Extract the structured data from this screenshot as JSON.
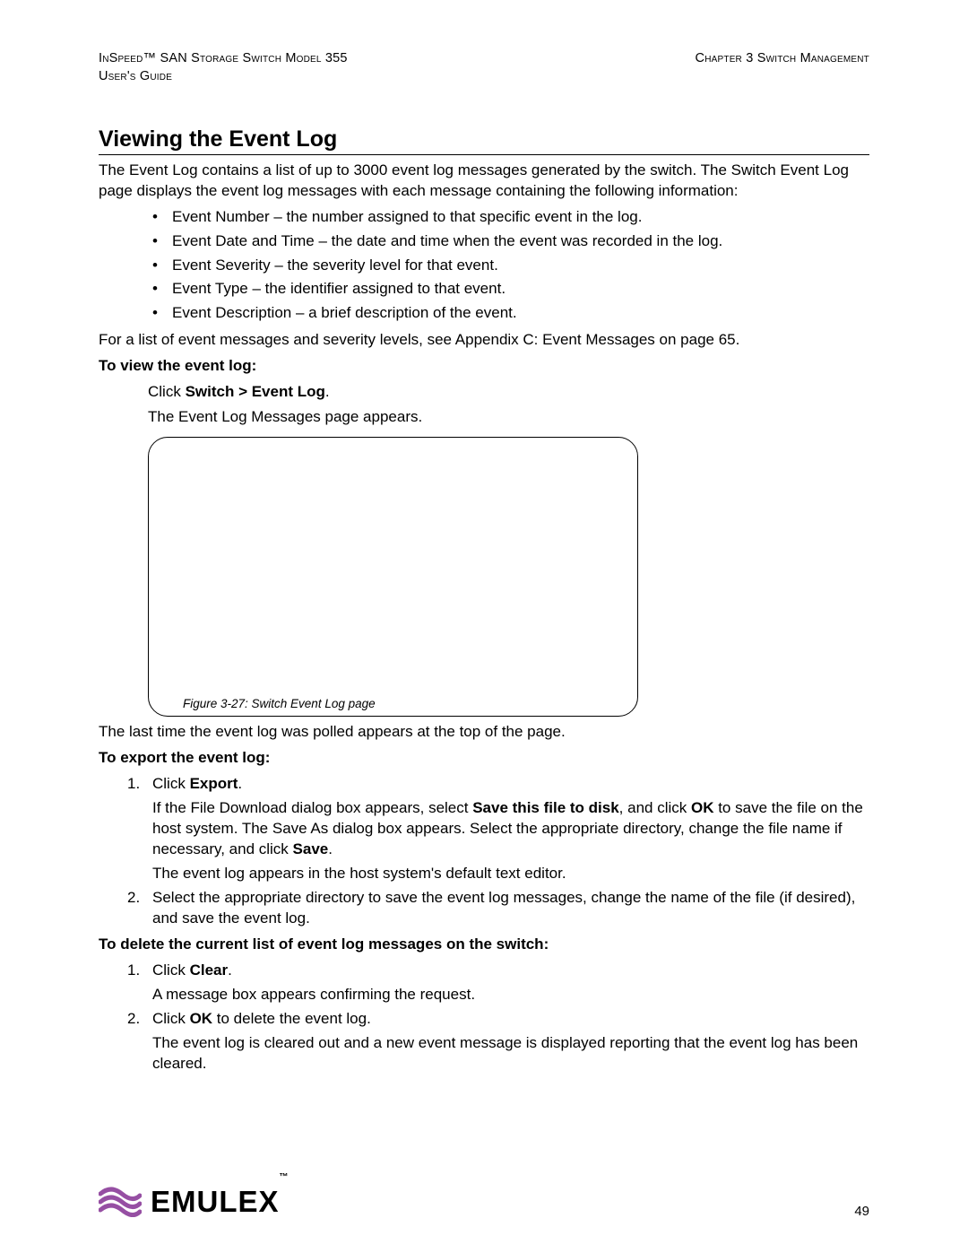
{
  "header": {
    "product_line1": "InSpeed™ SAN Storage Switch Model 355",
    "product_line2": "User's Guide",
    "chapter": "Chapter 3 Switch Management"
  },
  "section_title": "Viewing the Event Log",
  "intro": "The Event Log contains a list of up to 3000 event log messages generated by the switch. The Switch Event Log page displays the event log messages with each message containing the following information:",
  "fields": [
    "Event Number – the number assigned to that specific event in the log.",
    "Event Date and Time – the date and time when the event was recorded in the log.",
    "Event Severity – the severity level for that event.",
    "Event Type – the identifier assigned to that event.",
    "Event Description – a brief description of the event."
  ],
  "appendix_ref": "For a list of event messages and severity levels, see Appendix C: Event Messages on page 65.",
  "view": {
    "heading": "To view the event log:",
    "click_prefix": "Click ",
    "click_bold": "Switch > Event Log",
    "click_suffix": ".",
    "result": "The Event Log Messages page appears."
  },
  "figure_caption": "Figure 3-27: Switch Event Log page",
  "poll_note": "The last time the event log was polled appears at the top of the page.",
  "export": {
    "heading": "To export the event log:",
    "step1_click_prefix": "Click ",
    "step1_click_bold": "Export",
    "step1_click_suffix": ".",
    "step1_body_a": "If the File Download dialog box appears, select ",
    "step1_body_bold1": "Save this file to disk",
    "step1_body_b": ", and click ",
    "step1_body_bold2": "OK",
    "step1_body_c": " to save the file on the host system. The Save As dialog box appears. Select the appropriate directory, change the file name if necessary, and click ",
    "step1_body_bold3": "Save",
    "step1_body_d": ".",
    "step1_body2": "The event log appears in the host system's default text editor.",
    "step2": "Select the appropriate directory to save the event log messages, change the name of the file (if desired), and save the event log."
  },
  "delete": {
    "heading": "To delete the current list of event log messages on the switch:",
    "step1_click_prefix": "Click ",
    "step1_click_bold": "Clear",
    "step1_click_suffix": ".",
    "step1_body": "A message box appears confirming the request.",
    "step2_a": "Click ",
    "step2_bold": "OK",
    "step2_b": " to delete the event log.",
    "step2_body": "The event log is cleared out and a new event message is displayed reporting that the event log has been cleared."
  },
  "footer": {
    "brand": "EMULEX",
    "page": "49"
  }
}
